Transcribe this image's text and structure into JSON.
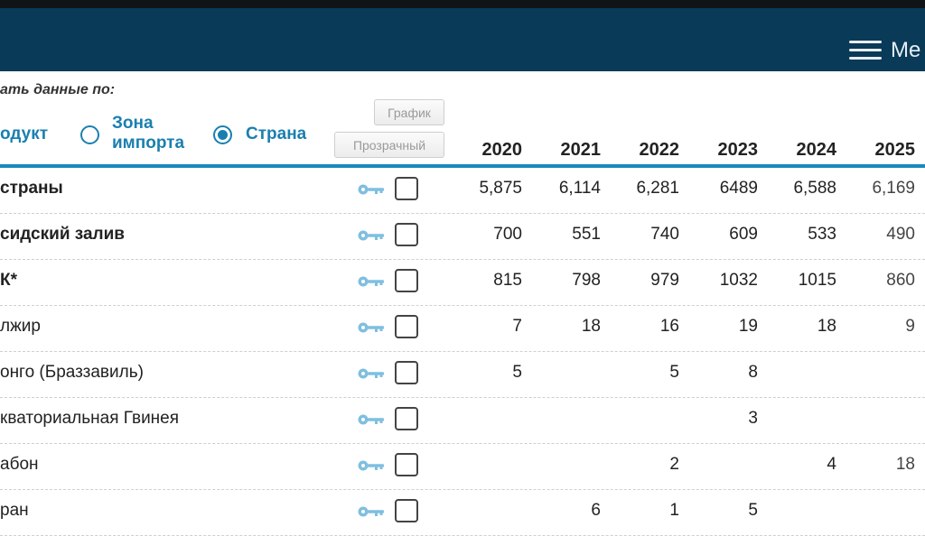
{
  "header": {
    "menu_label": "Me"
  },
  "filters": {
    "caption": "ать данные по:",
    "options": [
      {
        "label": "одукт",
        "selected": false
      },
      {
        "label_line1": "Зона",
        "label_line2": "импорта",
        "selected": false
      },
      {
        "label": "Страна",
        "selected": true
      }
    ],
    "buttons": {
      "chart": "График",
      "transparent": "Прозрачный"
    }
  },
  "colors": {
    "accent": "#1a88bd",
    "header_bg": "#093a58",
    "key_icon": "#7fbfe0"
  },
  "table": {
    "years": [
      "2020",
      "2021",
      "2022",
      "2023",
      "2024",
      "2025"
    ],
    "rows": [
      {
        "name": "страны",
        "bold": true,
        "values": [
          "5,875",
          "6,114",
          "6,281",
          "6489",
          "6,588",
          "6,169"
        ]
      },
      {
        "name": "сидский залив",
        "bold": true,
        "values": [
          "700",
          "551",
          "740",
          "609",
          "533",
          "490"
        ]
      },
      {
        "name": "К*",
        "bold": true,
        "values": [
          "815",
          "798",
          "979",
          "1032",
          "1015",
          "860"
        ]
      },
      {
        "name": "лжир",
        "bold": false,
        "values": [
          "7",
          "18",
          "16",
          "19",
          "18",
          "9"
        ]
      },
      {
        "name": "онго (Браззавиль)",
        "bold": false,
        "values": [
          "5",
          "",
          "5",
          "8",
          "",
          ""
        ]
      },
      {
        "name": "кваториальная Гвинея",
        "bold": false,
        "values": [
          "",
          "",
          "",
          "3",
          "",
          ""
        ]
      },
      {
        "name": "абон",
        "bold": false,
        "values": [
          "",
          "",
          "2",
          "",
          "4",
          "18"
        ]
      },
      {
        "name": "ран",
        "bold": false,
        "values": [
          "",
          "6",
          "1",
          "5",
          "",
          ""
        ]
      }
    ]
  }
}
